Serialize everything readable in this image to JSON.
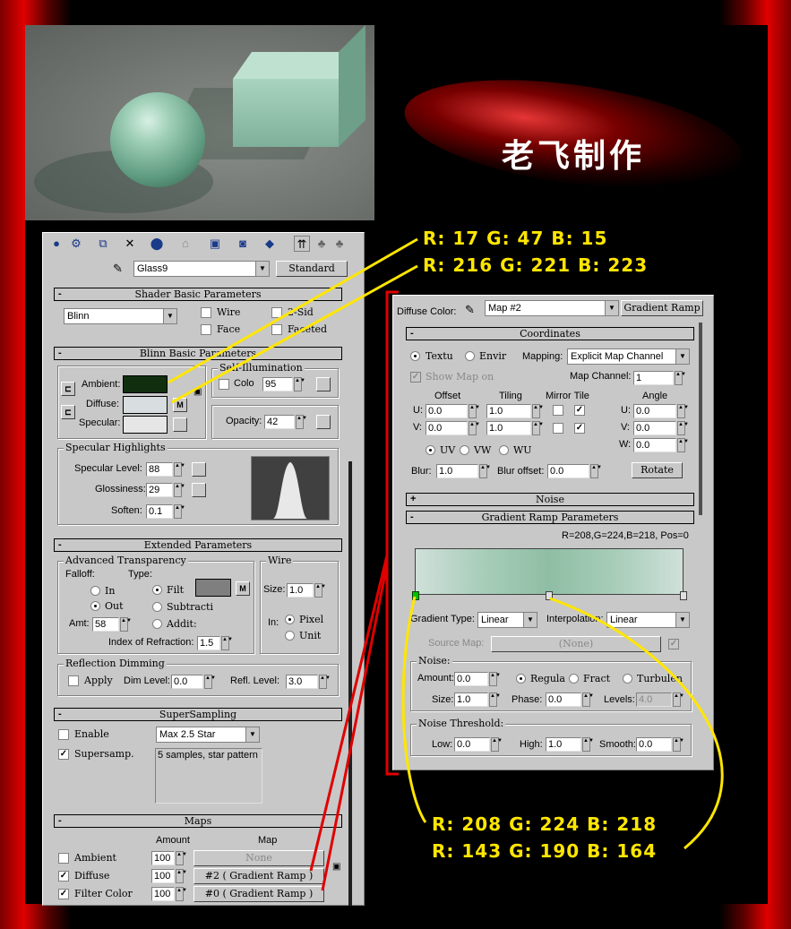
{
  "logo_text": "老飞制作",
  "annotations": {
    "ambient_rgb": "R: 17  G: 47  B: 15",
    "diffuse_rgb": "R: 216  G: 221  B: 223",
    "ramp_left_rgb": "R: 208  G: 224  B: 218",
    "ramp_mid_rgb": "R: 143  G: 190  B: 164"
  },
  "toolbar_icons": [
    "get-material-icon",
    "put-to-scene-icon",
    "assign-icon",
    "reset-icon",
    "make-unique-icon",
    "put-to-library-icon",
    "material-effects-icon",
    "show-map-icon",
    "show-end-result-icon",
    "go-to-parent-icon",
    "go-forward-icon",
    "go-sibling-icon"
  ],
  "material": {
    "name": "Glass9",
    "type": "Standard"
  },
  "shader_basic": {
    "title": "Shader Basic Parameters",
    "shader": "Blinn",
    "wire": "Wire",
    "two_sided": "2-Sid",
    "face_map": "Face",
    "faceted": "Faceted"
  },
  "blinn_basic": {
    "title": "Blinn Basic Parameters",
    "ambient": "Ambient:",
    "diffuse": "Diffuse:",
    "specular": "Specular:",
    "ambient_color": "#112f0f",
    "diffuse_color": "#d8dddf",
    "specular_color": "#e6e6e6",
    "m_label": "M",
    "self_illum_title": "Self-Illumination",
    "color_label": "Colo",
    "color_value": "95",
    "opacity_label": "Opacity:",
    "opacity_value": "42"
  },
  "specular_highlights": {
    "title": "Specular Highlights",
    "level_label": "Specular Level:",
    "level": "88",
    "gloss_label": "Glossiness:",
    "gloss": "29",
    "soften_label": "Soften:",
    "soften": "0.1"
  },
  "extended": {
    "title": "Extended Parameters",
    "adv_title": "Advanced Transparency",
    "falloff": "Falloff:",
    "type": "Type:",
    "in": "In",
    "out": "Out",
    "filter": "Filt",
    "subtractive": "Subtracti",
    "additive": "Addit:",
    "amt_label": "Amt:",
    "amt": "58",
    "ior_label": "Index of Refraction:",
    "ior": "1.5",
    "wire_title": "Wire",
    "size_label": "Size:",
    "size": "1.0",
    "in_label": "In:",
    "pixels": "Pixel",
    "units": "Unit",
    "refl_title": "Reflection Dimming",
    "apply": "Apply",
    "dim_label": "Dim Level:",
    "dim": "0.0",
    "refl_label": "Refl. Level:",
    "refl": "3.0",
    "filter_color": "#7f7f7f",
    "m_label": "M"
  },
  "supersampling": {
    "title": "SuperSampling",
    "enable": "Enable",
    "method": "Max 2.5 Star",
    "supersamp": "Supersamp.",
    "description": "5 samples, star pattern"
  },
  "maps": {
    "title": "Maps",
    "amount_header": "Amount",
    "map_header": "Map",
    "rows": [
      {
        "label": "Ambient",
        "checked": false,
        "amount": "100",
        "map": "None"
      },
      {
        "label": "Diffuse",
        "checked": true,
        "amount": "100",
        "map": "#2  ( Gradient Ramp )"
      },
      {
        "label": "Filter Color",
        "checked": true,
        "amount": "100",
        "map": "#0  ( Gradient Ramp )"
      }
    ]
  },
  "map_editor": {
    "slot_label": "Diffuse Color:",
    "map_name": "Map #2",
    "map_type": "Gradient Ramp",
    "coordinates": {
      "title": "Coordinates",
      "texture": "Textu",
      "environ": "Envir",
      "mapping_label": "Mapping:",
      "mapping": "Explicit Map Channel",
      "show_map": "Show Map on",
      "channel_label": "Map Channel:",
      "channel": "1",
      "offset": "Offset",
      "tiling": "Tiling",
      "mirror_tile": "Mirror Tile",
      "angle": "Angle",
      "u_label": "U:",
      "v_label": "V:",
      "w_label": "W:",
      "u_offset": "0.0",
      "v_offset": "0.0",
      "u_tiling": "1.0",
      "v_tiling": "1.0",
      "u_angle": "0.0",
      "v_angle": "0.0",
      "w_angle": "0.0",
      "uv": "UV",
      "vw": "VW",
      "wu": "WU",
      "blur_label": "Blur:",
      "blur": "1.0",
      "blur_offset_label": "Blur offset:",
      "blur_offset": "0.0",
      "rotate": "Rotate"
    },
    "noise_title": "Noise",
    "gradient_ramp": {
      "title": "Gradient Ramp Parameters",
      "info": "R=208,G=224,B=218, Pos=0",
      "grad_type_label": "Gradient Type:",
      "grad_type": "Linear",
      "interp_label": "Interpolation:",
      "interp": "Linear",
      "source_map_label": "Source Map:",
      "source_map": "(None)",
      "noise_group": "Noise:",
      "amount_label": "Amount:",
      "amount": "0.0",
      "regular": "Regula",
      "fractal": "Fract",
      "turbulence": "Turbulen",
      "size_label": "Size:",
      "size": "1.0",
      "phase_label": "Phase:",
      "phase": "0.0",
      "levels_label": "Levels:",
      "levels": "4.0",
      "threshold_group": "Noise Threshold:",
      "low_label": "Low:",
      "low": "0.0",
      "high_label": "High:",
      "high": "1.0",
      "smooth_label": "Smooth:",
      "smooth": "0.0"
    }
  }
}
